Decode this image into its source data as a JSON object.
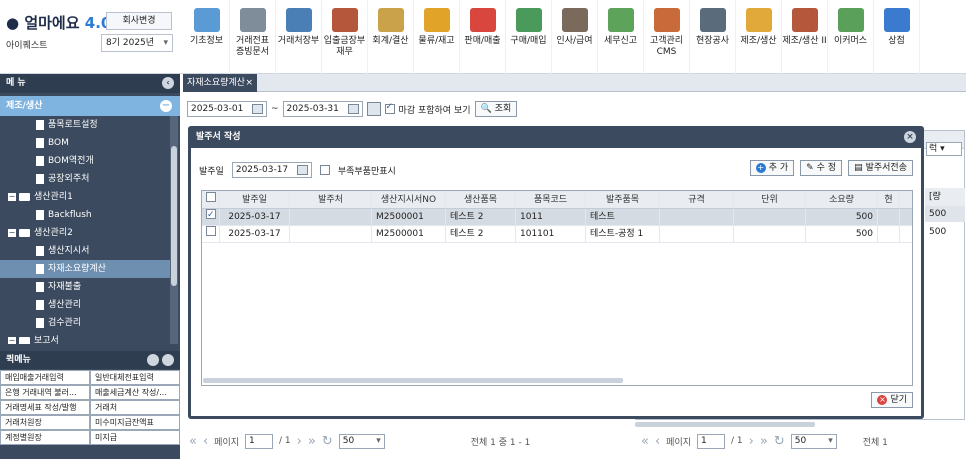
{
  "app": {
    "logo_main": "얼마에요",
    "logo_version": "4.0",
    "company": "아이퀘스트",
    "change_company": "회사변경",
    "year": "8기 2025년"
  },
  "menu": [
    {
      "label": "기초정보",
      "color": "#5b9bd5"
    },
    {
      "label": "거래전표\n증빙문서",
      "color": "#7f8c9a"
    },
    {
      "label": "거래처장부",
      "color": "#4a7fb5"
    },
    {
      "label": "입출금장부\n재무",
      "color": "#b5573a"
    },
    {
      "label": "회계/결산",
      "color": "#c9a24a"
    },
    {
      "label": "물류/재고",
      "color": "#e2a329"
    },
    {
      "label": "판매/매출",
      "color": "#d9463e"
    },
    {
      "label": "구매/매입",
      "color": "#4a9a5c"
    },
    {
      "label": "인사/급여",
      "color": "#7a6a5c"
    },
    {
      "label": "세무신고",
      "color": "#5da35a"
    },
    {
      "label": "고객관리\nCMS",
      "color": "#c96a3a"
    },
    {
      "label": "현장공사",
      "color": "#5a6b7b"
    },
    {
      "label": "제조/생산",
      "color": "#e0a93a"
    },
    {
      "label": "제조/생산 II",
      "color": "#b5573a"
    },
    {
      "label": "이커머스",
      "color": "#5aa05a"
    },
    {
      "label": "상점",
      "color": "#3a7bd0"
    }
  ],
  "sidebar": {
    "title": "메 뉴",
    "section": "제조/생산",
    "items": [
      {
        "label": "품목로트설정",
        "type": "doc",
        "indent": 1
      },
      {
        "label": "BOM",
        "type": "doc",
        "indent": 1
      },
      {
        "label": "BOM역전개",
        "type": "doc",
        "indent": 1
      },
      {
        "label": "공장외주처",
        "type": "doc",
        "indent": 1
      },
      {
        "label": "생산관리1",
        "type": "folder",
        "indent": 0
      },
      {
        "label": "Backflush",
        "type": "doc",
        "indent": 1
      },
      {
        "label": "생산관리2",
        "type": "folder",
        "indent": 0
      },
      {
        "label": "생산지시서",
        "type": "doc",
        "indent": 1
      },
      {
        "label": "자재소요량계산",
        "type": "doc",
        "indent": 1,
        "selected": true
      },
      {
        "label": "자재불출",
        "type": "doc",
        "indent": 1
      },
      {
        "label": "생산관리",
        "type": "doc",
        "indent": 1
      },
      {
        "label": "검수관리",
        "type": "doc",
        "indent": 1
      },
      {
        "label": "보고서",
        "type": "folder",
        "indent": 0
      }
    ],
    "quick_title": "퀵메뉴",
    "quick": [
      [
        "매입매출거래입력",
        "일반대체전표입력"
      ],
      [
        "은행 거래내역 불러...",
        "매출세금계산 작성/..."
      ],
      [
        "거래명세표 작성/발행",
        "거래처"
      ],
      [
        "거래처원장",
        "미수미지급잔액표"
      ],
      [
        "계정별원장",
        "미지급"
      ]
    ]
  },
  "tab": {
    "label": "자재소요량계산",
    "close": "×"
  },
  "filter": {
    "from": "2025-03-01",
    "tilde": "~",
    "to": "2025-03-31",
    "include_label": "마감 포함하여 보기",
    "search": "조회"
  },
  "background": {
    "select_label": "럭",
    "col_header": "[량",
    "v1": "500",
    "v2": "500"
  },
  "pager_left": {
    "page_label": "페이지",
    "page": "1",
    "of": "/ 1",
    "size": "50",
    "total": "전체 1 중 1 - 1"
  },
  "pager_right": {
    "page_label": "페이지",
    "page": "1",
    "of": "/ 1",
    "size": "50",
    "total": "전체 1"
  },
  "modal": {
    "title": "발주서 작성",
    "date_label": "발주일",
    "date": "2025-03-17",
    "shortage_label": "부족부품만표시",
    "btn_add": "추 가",
    "btn_edit": "수 정",
    "btn_send": "발주서전송",
    "btn_close": "닫기",
    "columns": [
      "",
      "발주일",
      "발주처",
      "생산지시서NO",
      "생산품목",
      "품목코드",
      "발주품목",
      "규격",
      "단위",
      "소요량",
      "현"
    ],
    "rows": [
      {
        "checked": true,
        "date": "2025-03-17",
        "vendor": "",
        "order_no": "M2500001",
        "product": "테스트 2",
        "code": "1011",
        "item": "테스트",
        "spec": "",
        "unit": "",
        "qty": "500"
      },
      {
        "checked": false,
        "date": "2025-03-17",
        "vendor": "",
        "order_no": "M2500001",
        "product": "테스트 2",
        "code": "101101",
        "item": "테스트-공정 1",
        "spec": "",
        "unit": "",
        "qty": "500"
      }
    ]
  }
}
